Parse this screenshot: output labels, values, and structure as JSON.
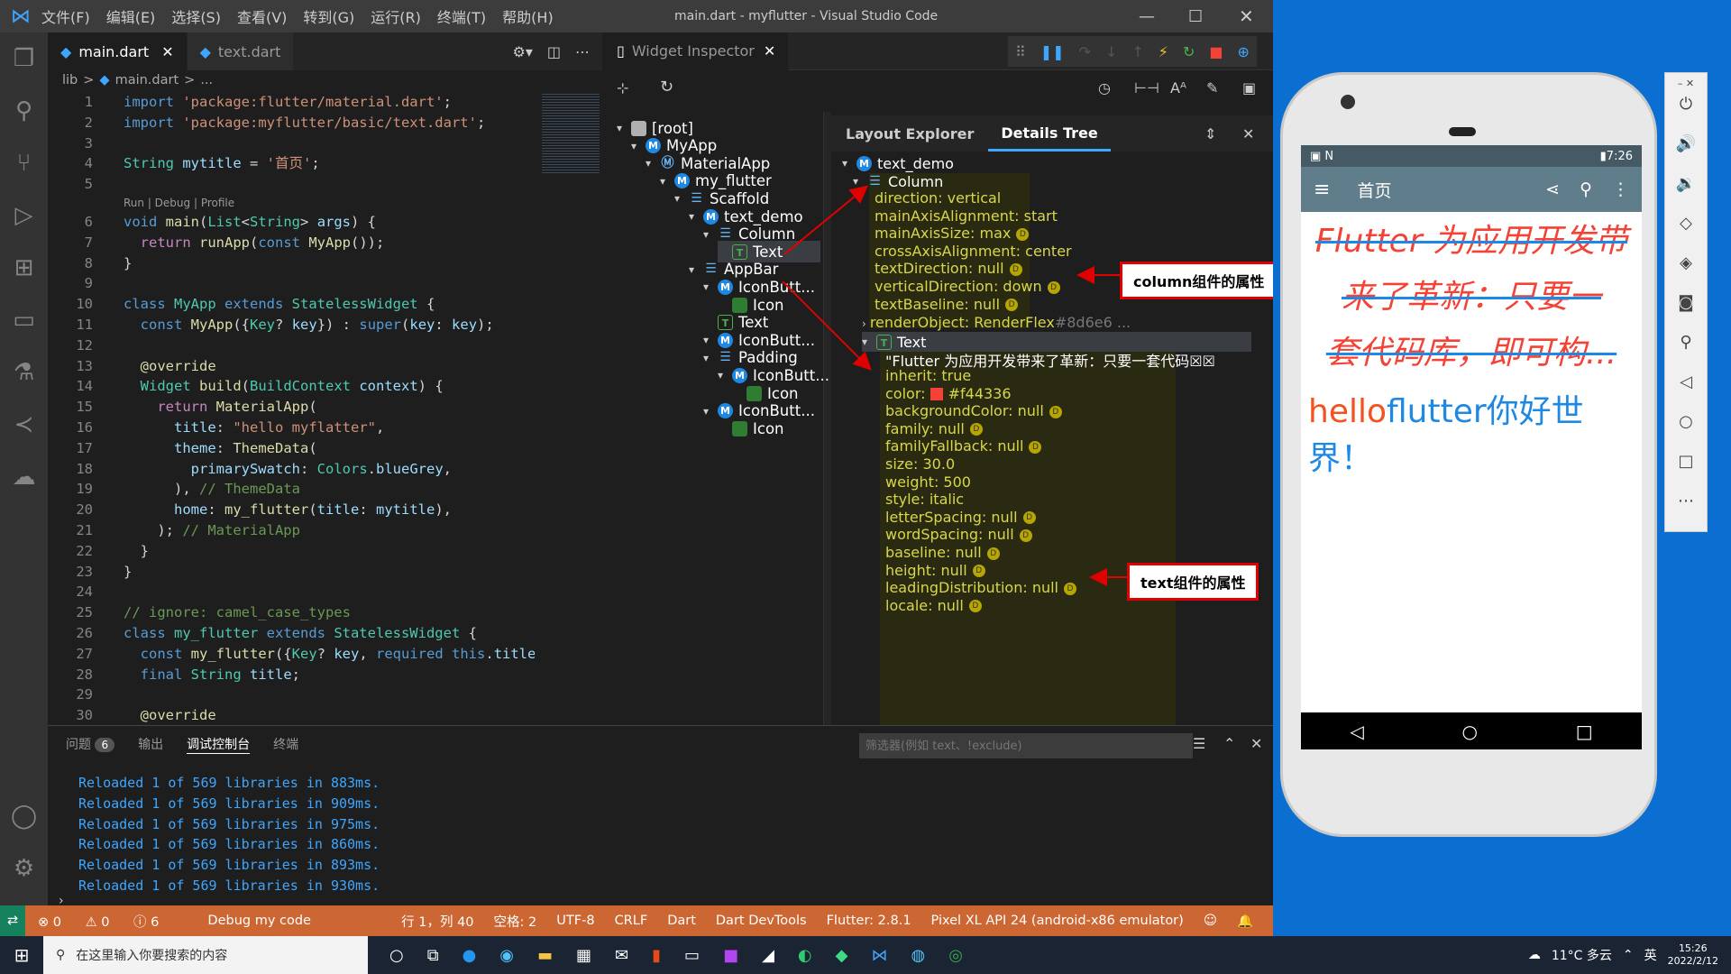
{
  "window": {
    "menu": [
      "文件(F)",
      "编辑(E)",
      "选择(S)",
      "查看(V)",
      "转到(G)",
      "运行(R)",
      "终端(T)",
      "帮助(H)"
    ],
    "title": "main.dart - myflutter - Visual Studio Code"
  },
  "editor": {
    "tabs": [
      "main.dart",
      "text.dart"
    ],
    "breadcrumb": [
      "lib",
      ">",
      "main.dart",
      ">",
      "..."
    ],
    "codelens": "Run | Debug | Profile",
    "lines": [
      [
        "1",
        [
          [
            "kw",
            "import "
          ],
          [
            "st",
            "'package:flutter/material.dart'"
          ],
          [
            "pl",
            ";"
          ]
        ]
      ],
      [
        "2",
        [
          [
            "kw",
            "import "
          ],
          [
            "st",
            "'package:myflutter/basic/text.dart'"
          ],
          [
            "pl",
            ";"
          ]
        ]
      ],
      [
        "3",
        []
      ],
      [
        "4",
        [
          [
            "ty",
            "String "
          ],
          [
            "vr",
            "mytitle"
          ],
          [
            "pl",
            " = "
          ],
          [
            "st",
            "'首页'"
          ],
          [
            "pl",
            ";"
          ]
        ]
      ],
      [
        "5",
        []
      ],
      [
        "6",
        [
          [
            "kw",
            "void "
          ],
          [
            "fn",
            "main"
          ],
          [
            "pl",
            "("
          ],
          [
            "ty",
            "List"
          ],
          [
            "pl",
            "<"
          ],
          [
            "ty",
            "String"
          ],
          [
            "pl",
            "> "
          ],
          [
            "vr",
            "args"
          ],
          [
            "pl",
            ") {"
          ]
        ]
      ],
      [
        "7",
        [
          [
            "pl",
            "  "
          ],
          [
            "kc",
            "return "
          ],
          [
            "fn",
            "runApp"
          ],
          [
            "pl",
            "("
          ],
          [
            "kw",
            "const "
          ],
          [
            "fn",
            "MyApp"
          ],
          [
            "pl",
            "());"
          ]
        ]
      ],
      [
        "8",
        [
          [
            "pl",
            "}"
          ]
        ]
      ],
      [
        "9",
        []
      ],
      [
        "10",
        [
          [
            "kw",
            "class "
          ],
          [
            "ty",
            "MyApp "
          ],
          [
            "kw",
            "extends "
          ],
          [
            "ty",
            "StatelessWidget "
          ],
          [
            "pl",
            "{"
          ]
        ]
      ],
      [
        "11",
        [
          [
            "pl",
            "  "
          ],
          [
            "kw",
            "const "
          ],
          [
            "fn",
            "MyApp"
          ],
          [
            "pl",
            "({"
          ],
          [
            "ty",
            "Key"
          ],
          [
            "pl",
            "? "
          ],
          [
            "vr",
            "key"
          ],
          [
            "pl",
            "}) : "
          ],
          [
            "kw",
            "super"
          ],
          [
            "pl",
            "("
          ],
          [
            "vr",
            "key"
          ],
          [
            "pl",
            ": "
          ],
          [
            "vr",
            "key"
          ],
          [
            "pl",
            ");"
          ]
        ]
      ],
      [
        "12",
        []
      ],
      [
        "13",
        [
          [
            "pl",
            "  "
          ],
          [
            "fn",
            "@override"
          ]
        ]
      ],
      [
        "14",
        [
          [
            "pl",
            "  "
          ],
          [
            "ty",
            "Widget "
          ],
          [
            "fn",
            "build"
          ],
          [
            "pl",
            "("
          ],
          [
            "ty",
            "BuildContext "
          ],
          [
            "vr",
            "context"
          ],
          [
            "pl",
            ") {"
          ]
        ]
      ],
      [
        "15",
        [
          [
            "pl",
            "    "
          ],
          [
            "kc",
            "return "
          ],
          [
            "fn",
            "MaterialApp"
          ],
          [
            "pl",
            "("
          ]
        ]
      ],
      [
        "16",
        [
          [
            "pl",
            "      "
          ],
          [
            "vr",
            "title"
          ],
          [
            "pl",
            ": "
          ],
          [
            "st",
            "\"hello myflatter\""
          ],
          [
            "pl",
            ","
          ]
        ]
      ],
      [
        "17",
        [
          [
            "pl",
            "      "
          ],
          [
            "vr",
            "theme"
          ],
          [
            "pl",
            ": "
          ],
          [
            "fn",
            "ThemeData"
          ],
          [
            "pl",
            "("
          ]
        ]
      ],
      [
        "18",
        [
          [
            "pl",
            "        "
          ],
          [
            "vr",
            "primarySwatch"
          ],
          [
            "pl",
            ": "
          ],
          [
            "ty",
            "Colors"
          ],
          [
            "pl",
            "."
          ],
          [
            "vr",
            "blueGrey"
          ],
          [
            "pl",
            ","
          ]
        ]
      ],
      [
        "19",
        [
          [
            "pl",
            "      ), "
          ],
          [
            "cm",
            "// ThemeData"
          ]
        ]
      ],
      [
        "20",
        [
          [
            "pl",
            "      "
          ],
          [
            "vr",
            "home"
          ],
          [
            "pl",
            ": "
          ],
          [
            "fn",
            "my_flutter"
          ],
          [
            "pl",
            "("
          ],
          [
            "vr",
            "title"
          ],
          [
            "pl",
            ": "
          ],
          [
            "vr",
            "mytitle"
          ],
          [
            "pl",
            "),"
          ]
        ]
      ],
      [
        "21",
        [
          [
            "pl",
            "    ); "
          ],
          [
            "cm",
            "// MaterialApp"
          ]
        ]
      ],
      [
        "22",
        [
          [
            "pl",
            "  }"
          ]
        ]
      ],
      [
        "23",
        [
          [
            "pl",
            "}"
          ]
        ]
      ],
      [
        "24",
        []
      ],
      [
        "25",
        [
          [
            "cm",
            "// ignore: camel_case_types"
          ]
        ]
      ],
      [
        "26",
        [
          [
            "kw",
            "class "
          ],
          [
            "ty",
            "my_flutter "
          ],
          [
            "kw",
            "extends "
          ],
          [
            "ty",
            "StatelessWidget "
          ],
          [
            "pl",
            "{"
          ]
        ]
      ],
      [
        "27",
        [
          [
            "pl",
            "  "
          ],
          [
            "kw",
            "const "
          ],
          [
            "fn",
            "my_flutter"
          ],
          [
            "pl",
            "({"
          ],
          [
            "ty",
            "Key"
          ],
          [
            "pl",
            "? "
          ],
          [
            "vr",
            "key"
          ],
          [
            "pl",
            ", "
          ],
          [
            "kw",
            "required "
          ],
          [
            "kw",
            "this"
          ],
          [
            "pl",
            "."
          ],
          [
            "vr",
            "title"
          ],
          [
            "pl",
            "}"
          ]
        ]
      ],
      [
        "28",
        [
          [
            "pl",
            "  "
          ],
          [
            "kw",
            "final "
          ],
          [
            "ty",
            "String "
          ],
          [
            "vr",
            "title"
          ],
          [
            "pl",
            ";"
          ]
        ]
      ],
      [
        "29",
        []
      ],
      [
        "30",
        [
          [
            "pl",
            "  "
          ],
          [
            "fn",
            "@override"
          ]
        ]
      ]
    ]
  },
  "inspector": {
    "tab": "Widget Inspector",
    "tab_layout": "Layout Explorer",
    "tab_details": "Details Tree",
    "tree": [
      [
        "[root]",
        "folder"
      ],
      [
        "MyApp",
        "b"
      ],
      [
        "MaterialApp",
        "m"
      ],
      [
        "my_flutter",
        "b"
      ],
      [
        "Scaffold",
        "s"
      ],
      [
        "text_demo",
        "b"
      ],
      [
        "Column",
        "c"
      ],
      [
        "Text",
        "t"
      ],
      [
        "AppBar",
        "a"
      ],
      [
        "IconButt...",
        "b"
      ],
      [
        "Icon",
        "g"
      ],
      [
        "Text",
        "t"
      ],
      [
        "IconButt...",
        "b"
      ],
      [
        "Padding",
        "a"
      ],
      [
        "IconButt...",
        "b"
      ],
      [
        "Icon",
        "g"
      ],
      [
        "IconButt...",
        "b"
      ],
      [
        "Icon",
        "g"
      ]
    ],
    "details_root": "text_demo",
    "details_column": "Column",
    "column_props": [
      [
        "direction",
        "vertical",
        false
      ],
      [
        "mainAxisAlignment",
        "start",
        false
      ],
      [
        "mainAxisSize",
        "max",
        true
      ],
      [
        "crossAxisAlignment",
        "center",
        false
      ],
      [
        "textDirection",
        "null",
        true
      ],
      [
        "verticalDirection",
        "down",
        true
      ],
      [
        "textBaseline",
        "null",
        true
      ]
    ],
    "render_object": "renderObject: RenderFlex",
    "render_object_id": "#8d6e6 ...",
    "details_text": "Text",
    "text_value": "\"Flutter 为应用开发带来了革新：只要一套代码☒☒",
    "text_props": [
      [
        "inherit",
        "true",
        false
      ],
      [
        "color",
        "#f44336",
        false
      ],
      [
        "backgroundColor",
        "null",
        true
      ],
      [
        "family",
        "null",
        true
      ],
      [
        "familyFallback",
        "null",
        true
      ],
      [
        "size",
        "30.0",
        false
      ],
      [
        "weight",
        "500",
        false
      ],
      [
        "style",
        "italic",
        false
      ],
      [
        "letterSpacing",
        "null",
        true
      ],
      [
        "wordSpacing",
        "null",
        true
      ],
      [
        "baseline",
        "null",
        true
      ],
      [
        "height",
        "null",
        true
      ],
      [
        "leadingDistribution",
        "null",
        true
      ],
      [
        "locale",
        "null",
        true
      ]
    ],
    "annot_column": "column组件的属性",
    "annot_text": "text组件的属性"
  },
  "panel": {
    "tabs": [
      "问题",
      "输出",
      "调试控制台",
      "终端"
    ],
    "problems_count": "6",
    "filter_placeholder": "筛选器(例如 text、!exclude)",
    "lines": [
      "Reloaded 1 of 569 libraries in 883ms.",
      "Reloaded 1 of 569 libraries in 909ms.",
      "Reloaded 1 of 569 libraries in 975ms.",
      "Reloaded 1 of 569 libraries in 860ms.",
      "Reloaded 1 of 569 libraries in 893ms.",
      "Reloaded 1 of 569 libraries in 930ms."
    ]
  },
  "status": {
    "errors": "0",
    "warnings": "0",
    "info": "6",
    "debug": "Debug my code",
    "position": "行 1，列 40",
    "spaces": "空格: 2",
    "encoding": "UTF-8",
    "eol": "CRLF",
    "lang": "Dart",
    "devtools": "Dart DevTools",
    "flutter": "Flutter: 2.8.1",
    "device": "Pixel XL API 24 (android-x86 emulator)"
  },
  "taskbar": {
    "search_placeholder": "在这里输入你要搜索的内容",
    "weather": "11°C 多云",
    "time": "15:26",
    "date": "2022/2/12",
    "lang": "英"
  },
  "phone": {
    "status_time": "7:26",
    "appbar_title": "首页",
    "big_text": [
      "Flutter 为应用开发带",
      "来了革新：只要一",
      "套代码库，即可构..."
    ],
    "rich_a": "hello",
    "rich_b": "flutter",
    "rich_c": "你好世界！"
  },
  "colors": {
    "accent": "#cc6633",
    "red": "#f44336",
    "blue": "#1e88e5",
    "appbar": "#607d8b"
  }
}
